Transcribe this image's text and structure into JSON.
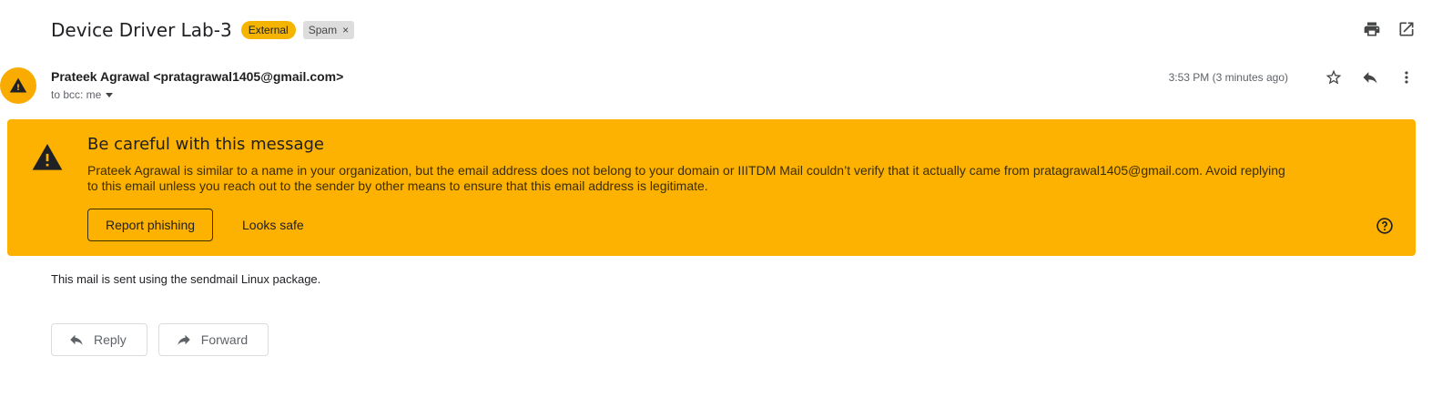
{
  "subject": "Device Driver Lab-3",
  "labels": {
    "external": "External",
    "spam": "Spam",
    "spam_remove": "×"
  },
  "sender": {
    "display": "Prateek Agrawal <pratagrawal1405@gmail.com>",
    "recipient": "to bcc: me",
    "timestamp": "3:53 PM (3 minutes ago)"
  },
  "warning": {
    "title": "Be careful with this message",
    "text": "Prateek Agrawal is similar to a name in your organization, but the email address does not belong to your domain or IIITDM Mail couldn’t verify that it actually came from pratagrawal1405@gmail.com. Avoid replying to this email unless you reach out to the sender by other means to ensure that this email address is legitimate.",
    "report_label": "Report phishing",
    "safe_label": "Looks safe",
    "color": "#fdb100"
  },
  "body": "This mail is sent using the sendmail Linux package.",
  "actions": {
    "reply": "Reply",
    "forward": "Forward"
  },
  "icons": [
    "print-icon",
    "open-in-new-window-icon",
    "star-icon",
    "reply-icon",
    "more-vert-icon",
    "warning-icon",
    "help-icon",
    "forward-icon"
  ]
}
